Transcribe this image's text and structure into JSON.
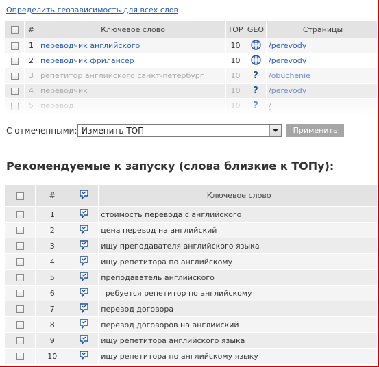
{
  "top_link": "Определить геозависимость для всех слов",
  "table1": {
    "headers": {
      "num": "#",
      "keyword": "Ключевое слово",
      "top": "TOP",
      "geo": "GEO",
      "pages": "Страницы"
    },
    "rows": [
      {
        "num": "1",
        "keyword": "переводчик английского",
        "top": "10",
        "geo": "globe-icon",
        "page": "/perevody"
      },
      {
        "num": "2",
        "keyword": "переводчик фрилансер",
        "top": "10",
        "geo": "globe-icon",
        "page": "/perevody"
      },
      {
        "num": "3",
        "keyword": "репетитор английского санкт-петербург",
        "top": "10",
        "geo": "?",
        "page": "/obuchenie"
      },
      {
        "num": "4",
        "keyword": "переводчик",
        "top": "10",
        "geo": "?",
        "page": "/perevody"
      },
      {
        "num": "5",
        "keyword": "перевод",
        "top": "10",
        "geo": "?",
        "page": "/"
      }
    ]
  },
  "actions": {
    "label": "С отмеченными:",
    "select_value": "Изменить ТОП",
    "apply_label": "Применить"
  },
  "heading": "Рекомендуемые к запуску (слова близкие к ТОПу):",
  "table2": {
    "headers": {
      "num": "#",
      "keyword": "Ключевое слово"
    },
    "rows": [
      {
        "num": "1",
        "keyword": "стоимость перевода с английского"
      },
      {
        "num": "2",
        "keyword": "цена перевод на английский"
      },
      {
        "num": "3",
        "keyword": "ищу преподавателя английского языка"
      },
      {
        "num": "4",
        "keyword": "ищу репетитора по английскому"
      },
      {
        "num": "5",
        "keyword": "преподаватель английского"
      },
      {
        "num": "6",
        "keyword": "требуется репетитор по английскому"
      },
      {
        "num": "7",
        "keyword": "перевод договора"
      },
      {
        "num": "8",
        "keyword": "перевод договоров на английский"
      },
      {
        "num": "9",
        "keyword": "ищу репетитора английского языка"
      },
      {
        "num": "10",
        "keyword": "ищу репетитора по английскому языку"
      }
    ]
  },
  "colors": {
    "link": "#2a5db0",
    "header_bg": "#e3e3e3",
    "row_bg": "#ececec",
    "frame": "#cc0000"
  }
}
